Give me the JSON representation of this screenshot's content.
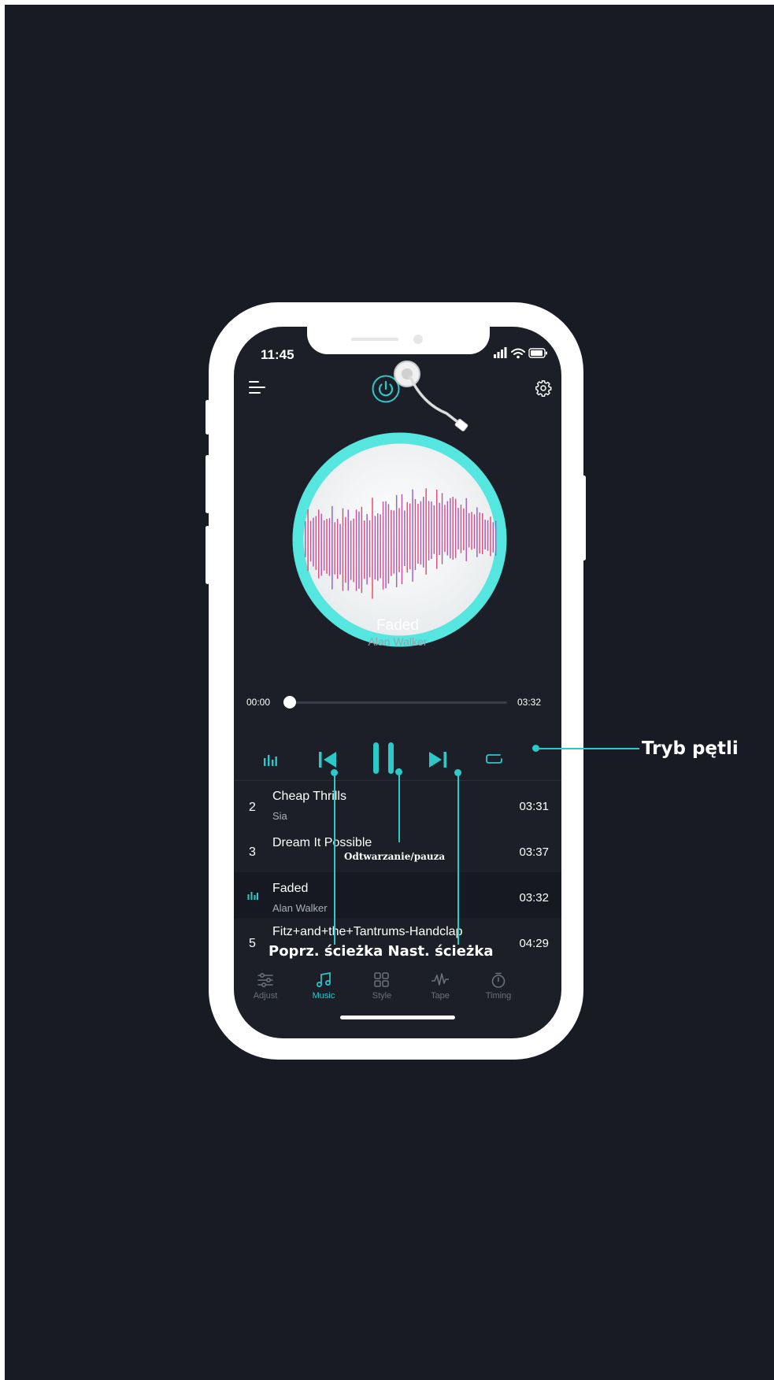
{
  "status_bar": {
    "time": "11:45"
  },
  "now_playing": {
    "title": "Faded",
    "artist": "Alan Walker"
  },
  "progress": {
    "current": "00:00",
    "total": "03:32",
    "fraction": 0
  },
  "playlist": [
    {
      "num": "2",
      "title": "Cheap Thrills",
      "artist": "Sia",
      "duration": "03:31",
      "active": false
    },
    {
      "num": "3",
      "title": "Dream It Possible",
      "artist": "",
      "duration": "03:37",
      "active": false
    },
    {
      "num": "",
      "title": "Faded",
      "artist": "Alan Walker",
      "duration": "03:32",
      "active": true
    },
    {
      "num": "5",
      "title": "Fitz+and+the+Tantrums-Handclap",
      "artist": "",
      "duration": "04:29",
      "active": false
    }
  ],
  "tabs": [
    {
      "label": "Adjust",
      "icon": "sliders-icon"
    },
    {
      "label": "Music",
      "icon": "music-note-icon"
    },
    {
      "label": "Style",
      "icon": "grid-icon"
    },
    {
      "label": "Tape",
      "icon": "tape-wave-icon"
    },
    {
      "label": "Timing",
      "icon": "timer-icon"
    }
  ],
  "active_tab": "Music",
  "annotations": {
    "loop_mode": "Tryb pętli",
    "play_pause": "Odtwarzanie/pauza",
    "prev_next": "Poprz. ścieżka Nast. ścieżka"
  },
  "colors": {
    "accent": "#2dc8c8",
    "background": "#181b24",
    "screen": "#1c1f28",
    "phone_frame": "#ffffff"
  }
}
